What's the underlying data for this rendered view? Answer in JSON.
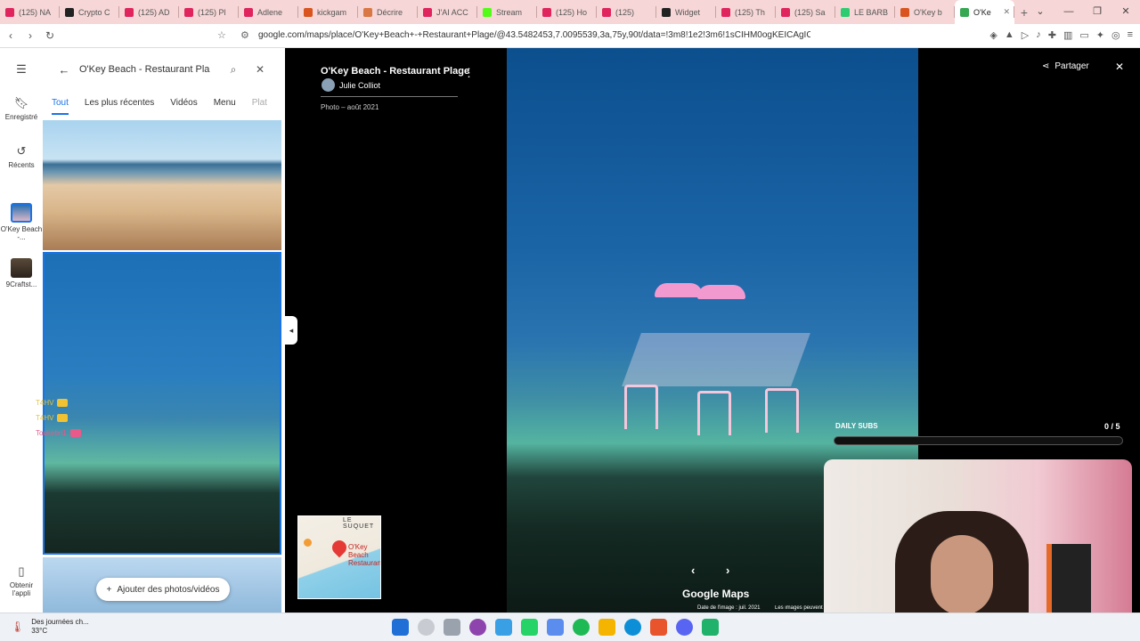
{
  "browser": {
    "tabs": [
      {
        "label": "(125) NA",
        "color": "#e0245e"
      },
      {
        "label": "Crypto C",
        "color": "#222222"
      },
      {
        "label": "(125) AD",
        "color": "#e0245e"
      },
      {
        "label": "(125) Pl",
        "color": "#e0245e"
      },
      {
        "label": "Adlene",
        "color": "#e0245e"
      },
      {
        "label": "kickgam",
        "color": "#d9541e"
      },
      {
        "label": "Décrire",
        "color": "#d97745"
      },
      {
        "label": "J'AI ACC",
        "color": "#e0245e"
      },
      {
        "label": "Stream",
        "color": "#53fc18"
      },
      {
        "label": "(125) Ho",
        "color": "#e0245e"
      },
      {
        "label": "(125)",
        "color": "#e0245e"
      },
      {
        "label": "Widget",
        "color": "#222222"
      },
      {
        "label": "(125) Th",
        "color": "#e0245e"
      },
      {
        "label": "(125) Sa",
        "color": "#e0245e"
      },
      {
        "label": "LE BARB",
        "color": "#2ecc71"
      },
      {
        "label": "O'Key b",
        "color": "#d9541e"
      },
      {
        "label": "O'Ke",
        "color": "#34a853",
        "active": true
      }
    ],
    "new_tab": "+",
    "url": "google.com/maps/place/O'Key+Beach+-+Restaurant+Plage/@43.5482453,7.0095539,3a,75y,90t/data=!3m8!1e2!3m6!1sCIHM0ogKEICAgICanoiA3g..."
  },
  "rail": {
    "items": [
      {
        "label": "Enregistré",
        "icon": "bookmark-icon"
      },
      {
        "label": "Récents",
        "icon": "history-icon"
      },
      {
        "label": "O'Key Beach -...",
        "icon": "place-thumb"
      },
      {
        "label": "9Craftst...",
        "icon": "place-thumb"
      },
      {
        "label": "Obtenir l'appli",
        "icon": "phone-icon"
      }
    ]
  },
  "panel": {
    "search_value": "O'Key Beach - Restaurant Pla",
    "tabs": [
      "Tout",
      "Les plus récentes",
      "Vidéos",
      "Menu",
      "Plat"
    ],
    "active_tab": "Tout",
    "add_button": "Ajouter des photos/vidéos"
  },
  "viewer": {
    "title": "O'Key Beach - Restaurant Plage",
    "author": "Julie Colliot",
    "photo_date": "Photo – août 2021",
    "share_label": "Partager",
    "brand": "Google Maps",
    "image_date": "Date de l'image : juil. 2021",
    "image_note": "Les images peuvent"
  },
  "minimap": {
    "street": "LE SUQUET",
    "place_label": "O'Key Beach Restaurant"
  },
  "overlay": {
    "subs_label": "DAILY SUBS",
    "subs_count": "0 / 5",
    "subs_progress": 0,
    "chat": [
      {
        "user": "T4HV"
      },
      {
        "user": "T4HV"
      },
      {
        "user": "Toukebri1"
      }
    ]
  },
  "taskbar": {
    "weather_text": "Des journées ch...",
    "temperature": "33°C"
  }
}
